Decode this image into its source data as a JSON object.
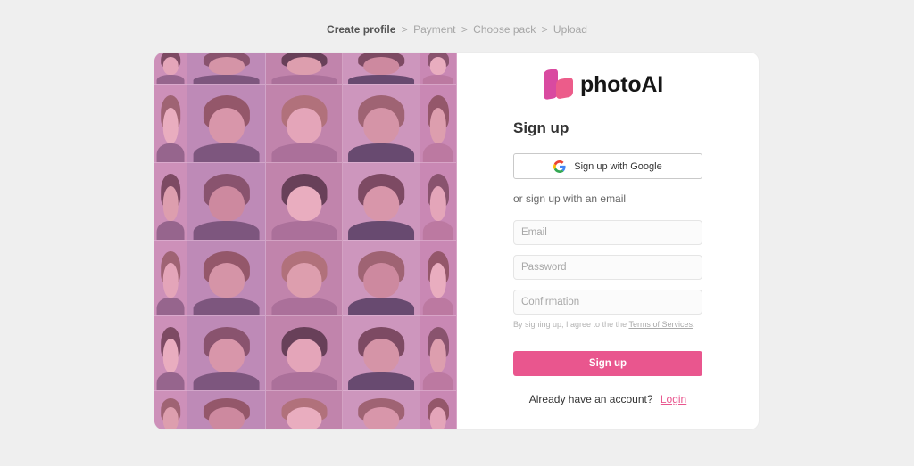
{
  "breadcrumb": {
    "steps": [
      "Create profile",
      "Payment",
      "Choose pack",
      "Upload"
    ],
    "separator": ">"
  },
  "brand": {
    "name": "photoAI",
    "accent": "#e9568e",
    "logo_colors": [
      "#d94aa0",
      "#ec5c8a"
    ]
  },
  "form": {
    "title": "Sign up",
    "google_button": "Sign up with Google",
    "google_icon": "google-g-icon",
    "or_text": "or sign up with an email",
    "email_placeholder": "Email",
    "password_placeholder": "Password",
    "confirmation_placeholder": "Confirmation",
    "terms_prefix": "By signing up, I agree to the the ",
    "terms_link": "Terms of Services",
    "terms_suffix": ".",
    "submit": "Sign up",
    "login_prompt": "Already have an account?",
    "login_link": "Login"
  }
}
